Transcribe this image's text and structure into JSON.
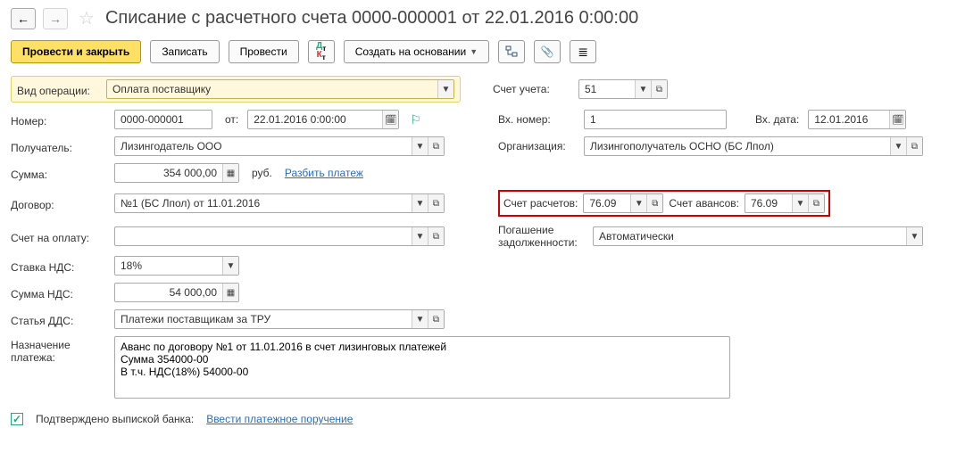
{
  "header": {
    "title": "Списание с расчетного счета 0000-000001 от 22.01.2016 0:00:00"
  },
  "toolbar": {
    "post_close": "Провести и закрыть",
    "save": "Записать",
    "post": "Провести",
    "create_based": "Создать на основании"
  },
  "labels": {
    "op_type": "Вид операции:",
    "account": "Счет учета:",
    "number": "Номер:",
    "from": "от:",
    "in_number": "Вх. номер:",
    "in_date": "Вх. дата:",
    "recipient": "Получатель:",
    "organization": "Организация:",
    "amount": "Сумма:",
    "currency": "руб.",
    "split_link": "Разбить платеж",
    "contract": "Договор:",
    "settle_acct": "Счет расчетов:",
    "advance_acct": "Счет авансов:",
    "invoice": "Счет на оплату:",
    "repay": "Погашение задолженности:",
    "vat_rate": "Ставка НДС:",
    "vat_sum": "Сумма НДС:",
    "dds": "Статья ДДС:",
    "purpose": "Назначение платежа:",
    "confirmed": "Подтверждено выпиской банка:",
    "enter_order": "Ввести платежное поручение"
  },
  "values": {
    "op_type": "Оплата поставщику",
    "account": "51",
    "number": "0000-000001",
    "date": "22.01.2016  0:00:00",
    "in_number": "1",
    "in_date": "12.01.2016",
    "recipient": "Лизингодатель ООО",
    "organization": "Лизингополучатель ОСНО (БС Лпол)",
    "amount": "354 000,00",
    "contract": "№1 (БС Лпол) от 11.01.2016",
    "settle_acct": "76.09",
    "advance_acct": "76.09",
    "repay": "Автоматически",
    "vat_rate": "18%",
    "vat_sum": "54 000,00",
    "dds": "Платежи поставщикам за ТРУ",
    "purpose": "Аванс по договору №1 от 11.01.2016 в счет лизинговых платежей\nСумма 354000-00\nВ т.ч. НДС(18%) 54000-00"
  }
}
